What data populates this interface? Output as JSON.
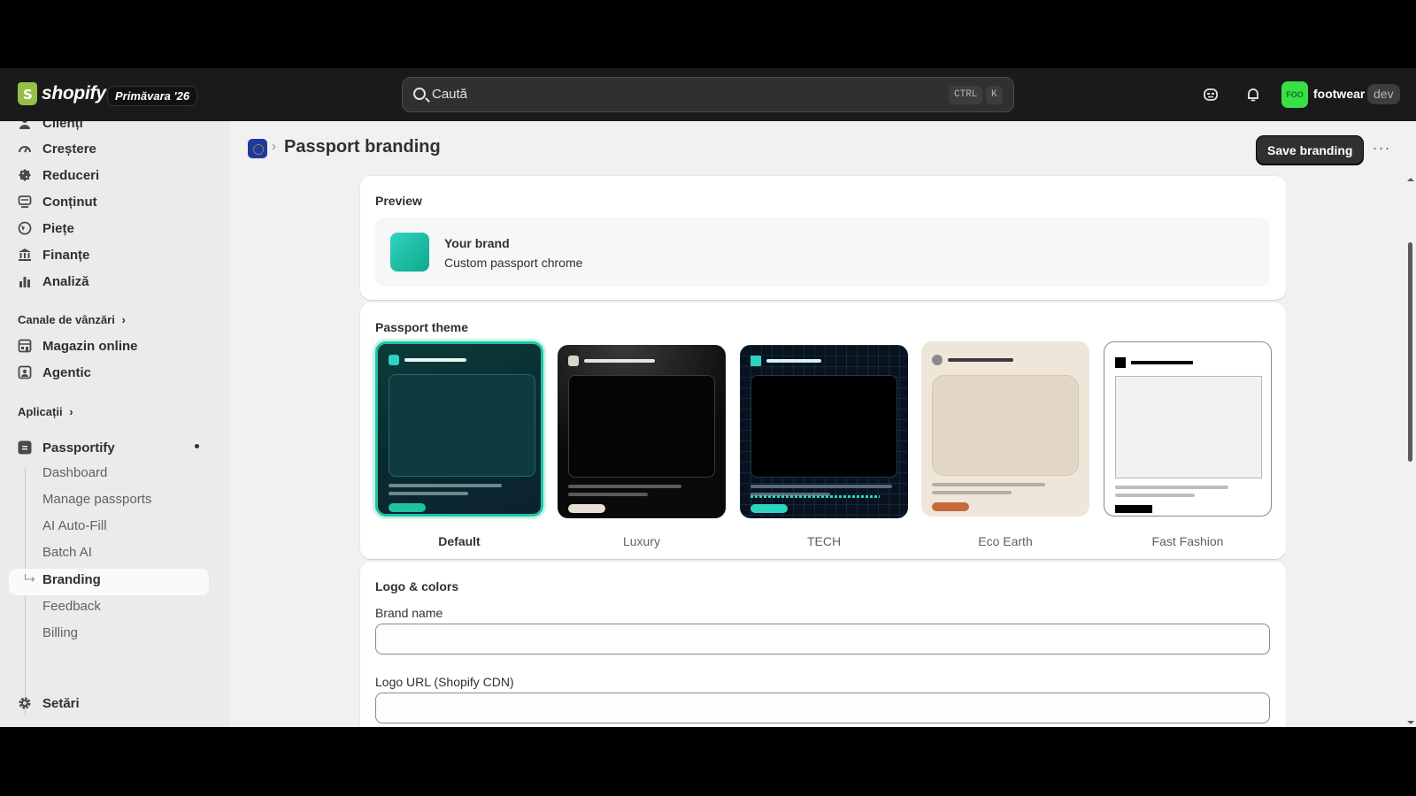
{
  "topbar": {
    "brand": "shopify",
    "edition": "Primăvara '26",
    "search_placeholder": "Caută",
    "shortcut_ctrl": "CTRL",
    "shortcut_k": "K",
    "store_initials": "FOO",
    "store_name": "footwear",
    "store_badge": "dev"
  },
  "sidebar": {
    "items_top": [
      {
        "label": "Clienți",
        "icon": "person-icon"
      },
      {
        "label": "Creștere",
        "icon": "growth-icon"
      },
      {
        "label": "Reduceri",
        "icon": "discount-icon"
      },
      {
        "label": "Conținut",
        "icon": "content-icon"
      },
      {
        "label": "Piețe",
        "icon": "globe-icon"
      },
      {
        "label": "Finanțe",
        "icon": "bank-icon"
      },
      {
        "label": "Analiză",
        "icon": "chart-icon"
      }
    ],
    "channels_head": "Canale de vânzări",
    "channels": [
      {
        "label": "Magazin online",
        "icon": "store-icon"
      },
      {
        "label": "Agentic",
        "icon": "agentic-icon"
      }
    ],
    "apps_head": "Aplicații",
    "app": {
      "label": "Passportify",
      "icon": "app-icon"
    },
    "app_sub": [
      "Dashboard",
      "Manage passports",
      "AI Auto-Fill",
      "Batch AI",
      "Branding",
      "Feedback",
      "Billing"
    ],
    "settings": "Setări"
  },
  "page": {
    "title": "Passport branding",
    "save_label": "Save branding",
    "more_label": "···"
  },
  "preview": {
    "title": "Preview",
    "brand": "Your brand",
    "subtitle": "Custom passport chrome",
    "swatch_color": "#1fc3a3"
  },
  "themes": {
    "title": "Passport theme",
    "selected": "Default",
    "items": [
      "Default",
      "Luxury",
      "TECH",
      "Eco Earth",
      "Fast Fashion"
    ]
  },
  "logo_colors": {
    "title": "Logo & colors",
    "brand_name_label": "Brand name",
    "brand_name_value": "",
    "logo_url_label": "Logo URL (Shopify CDN)",
    "logo_url_value": ""
  }
}
